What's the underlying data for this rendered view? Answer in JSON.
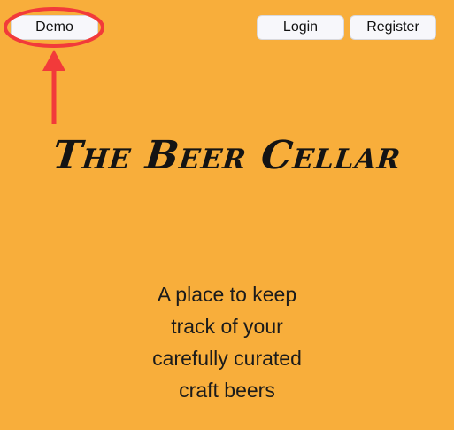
{
  "header": {
    "demo_label": "Demo",
    "login_label": "Login",
    "register_label": "Register"
  },
  "hero": {
    "title": "The Beer Cellar",
    "tagline_lines": [
      "A place to keep",
      "track of your",
      "carefully curated",
      "craft beers"
    ]
  },
  "colors": {
    "background": "#f8ae3b",
    "annotation": "#f23a3a",
    "button_bg": "#f7f7fb"
  },
  "icons": {
    "annotation_arrow": "arrow-up-icon",
    "annotation_circle": "highlight-ellipse"
  }
}
